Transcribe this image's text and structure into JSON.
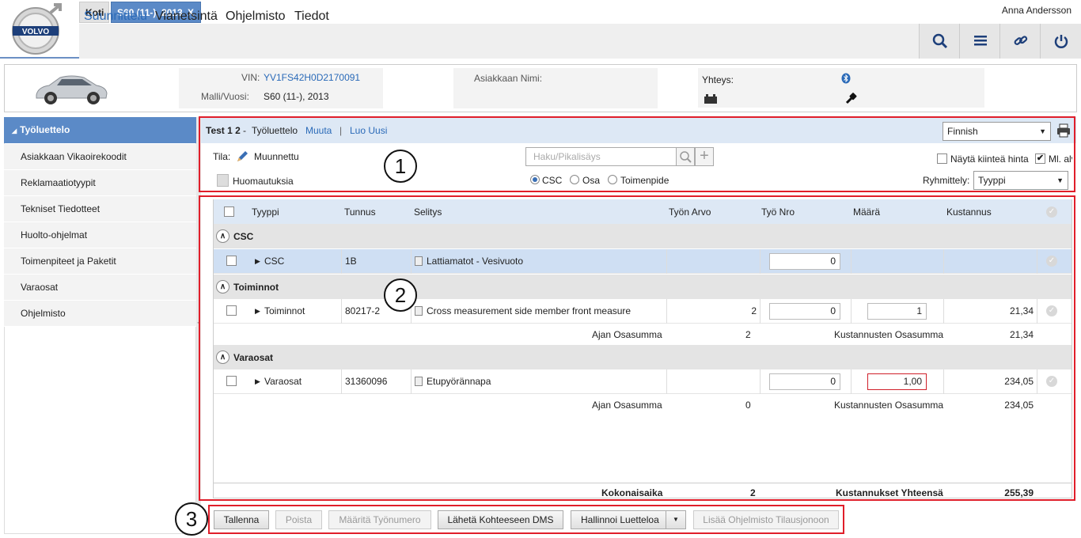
{
  "header": {
    "tabs": [
      {
        "label": "Koti"
      },
      {
        "label": "S60 (11-), 2013",
        "close": "X"
      }
    ],
    "nav": [
      "Suunnittelu",
      "Vianetsintä",
      "Ohjelmisto",
      "Tiedot"
    ],
    "user": "Anna Andersson",
    "icons": [
      "search-icon",
      "list-icon",
      "link-icon",
      "power-icon"
    ]
  },
  "vehicle": {
    "vin_label": "VIN:",
    "vin": "YV1FS42H0D2170091",
    "model_label": "Malli/Vuosi:",
    "model": "S60 (11-), 2013",
    "customer_label": "Asiakkaan Nimi:",
    "customer": "",
    "connection_label": "Yhteys:"
  },
  "sidebar": {
    "header": "Työluettelo",
    "items": [
      "Asiakkaan Vikaoirekoodit",
      "Reklamaatiotyypit",
      "Tekniset Tiedotteet",
      "Huolto-ohjelmat",
      "Toimenpiteet ja Paketit",
      "Varaosat",
      "Ohjelmisto"
    ]
  },
  "worklist": {
    "name": "Test 1 2",
    "sep": "-",
    "title": "Työluettelo",
    "edit": "Muuta",
    "pipe": "|",
    "create": "Luo Uusi",
    "language": "Finnish",
    "status_label": "Tila:",
    "status": "Muunnettu",
    "remarks": "Huomautuksia",
    "search_placeholder": "Haku/Pikalisäys",
    "radios": [
      "CSC",
      "Osa",
      "Toimenpide"
    ],
    "fixed_price": "Näytä kiinteä hinta",
    "vat": "Ml. alv",
    "group_label": "Ryhmittely:",
    "group_value": "Tyyppi"
  },
  "table": {
    "headers": [
      "Tyyppi",
      "Tunnus",
      "Selitys",
      "Työn Arvo",
      "Työ Nro",
      "Määrä",
      "Kustannus"
    ],
    "groups": [
      {
        "title": "CSC",
        "rows": [
          {
            "type": "CSC",
            "code": "1B",
            "desc": "Lattiamatot - Vesivuoto",
            "work_value": "",
            "work_no": "0",
            "qty": "",
            "cost": ""
          }
        ]
      },
      {
        "title": "Toiminnot",
        "rows": [
          {
            "type": "Toiminnot",
            "code": "80217-2",
            "desc": "Cross measurement side member front measure",
            "work_value": "2",
            "work_no": "0",
            "qty": "1",
            "cost": "21,34"
          }
        ],
        "subtotal": {
          "time_label": "Ajan Osasumma",
          "time": "2",
          "cost_label": "Kustannusten Osasumma",
          "cost": "21,34"
        }
      },
      {
        "title": "Varaosat",
        "rows": [
          {
            "type": "Varaosat",
            "code": "31360096",
            "desc": "Etupyörännapa",
            "work_value": "",
            "work_no": "0",
            "qty": "1,00",
            "cost": "234,05"
          }
        ],
        "subtotal": {
          "time_label": "Ajan Osasumma",
          "time": "0",
          "cost_label": "Kustannusten Osasumma",
          "cost": "234,05"
        }
      }
    ],
    "total": {
      "time_label": "Kokonaisaika",
      "time": "2",
      "cost_label": "Kustannukset Yhteensä",
      "cost": "255,39"
    }
  },
  "footer": {
    "buttons": [
      "Tallenna",
      "Poista",
      "Määritä Työnumero",
      "Lähetä Kohteeseen DMS",
      "Hallinnoi Luetteloa",
      "Lisää Ohjelmisto Tilausjonoon"
    ]
  },
  "callouts": [
    "1",
    "2",
    "3"
  ],
  "colors": {
    "accent": "#5b8ac7",
    "highlight": "#e01e2a",
    "link": "#2a6ab8"
  }
}
